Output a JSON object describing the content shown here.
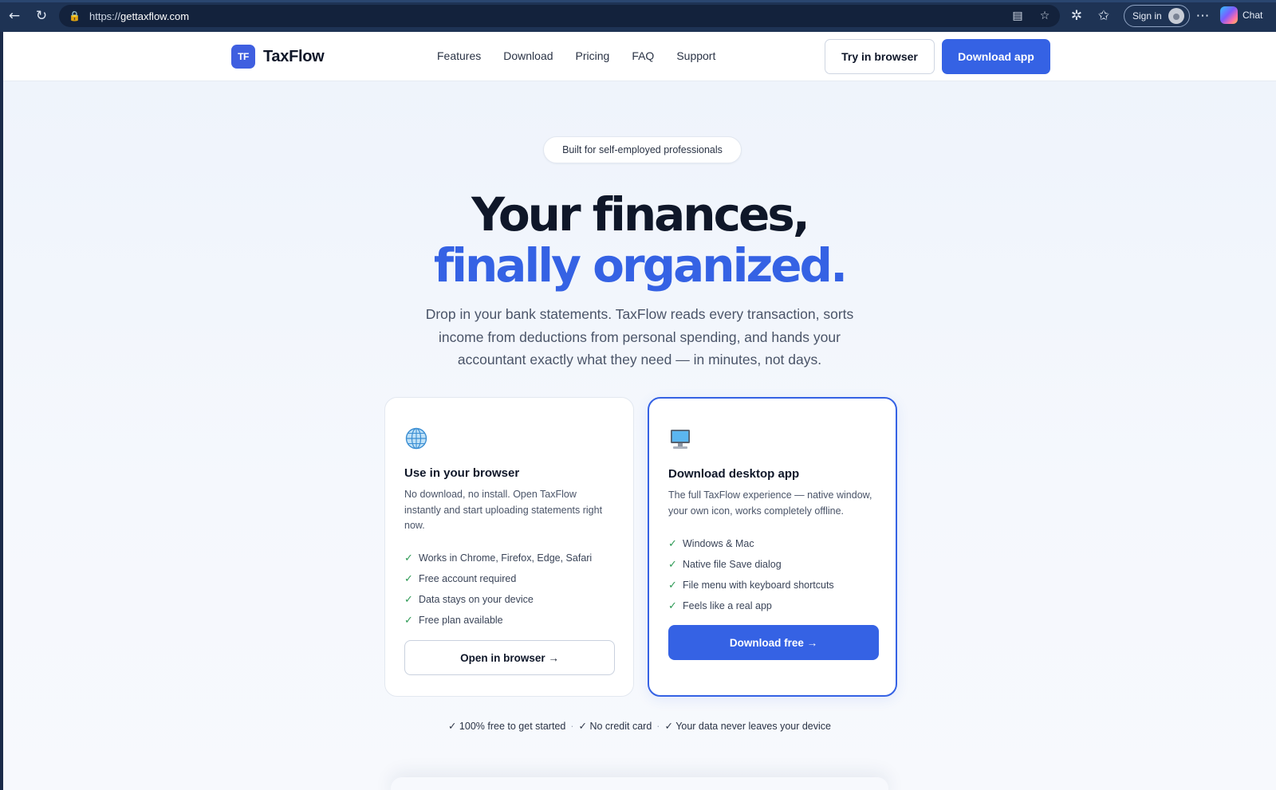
{
  "browser": {
    "url_prefix": "https://",
    "url_domain": "gettaxflow.com",
    "signin_label": "Sign in",
    "chat_label": "Chat"
  },
  "nav": {
    "logo_mark": "TF",
    "brand": "TaxFlow",
    "links": [
      "Features",
      "Download",
      "Pricing",
      "FAQ",
      "Support"
    ],
    "try_label": "Try in browser",
    "download_label": "Download app"
  },
  "hero": {
    "pill": "Built for self-employed professionals",
    "title_line1": "Your finances,",
    "title_line2": "finally organized.",
    "lede": "Drop in your bank statements. TaxFlow reads every transaction, sorts income from deductions from personal spending, and hands your accountant exactly what they need — in minutes, not days."
  },
  "cards": [
    {
      "icon": "globe-icon",
      "title": "Use in your browser",
      "desc": "No download, no install. Open TaxFlow instantly and start uploading statements right now.",
      "features": [
        "Works in Chrome, Firefox, Edge, Safari",
        "Free account required",
        "Data stays on your device",
        "Free plan available"
      ],
      "button": "Open in browser →"
    },
    {
      "icon": "desktop-computer-icon",
      "title": "Download desktop app",
      "desc": "The full TaxFlow experience — native window, your own icon, works completely offline.",
      "features": [
        "Windows & Mac",
        "Native file Save dialog",
        "File menu with keyboard shortcuts",
        "Feels like a real app"
      ],
      "button": "Download free →"
    }
  ],
  "checkmark": "✓",
  "footer_points": [
    "✓ 100% free to get started",
    "✓ No credit card",
    "✓ Your data never leaves your device"
  ],
  "colors": {
    "accent": "#3562e4",
    "chrome": "#1e3354",
    "check": "#2e9a55",
    "ink": "#0f1729"
  }
}
